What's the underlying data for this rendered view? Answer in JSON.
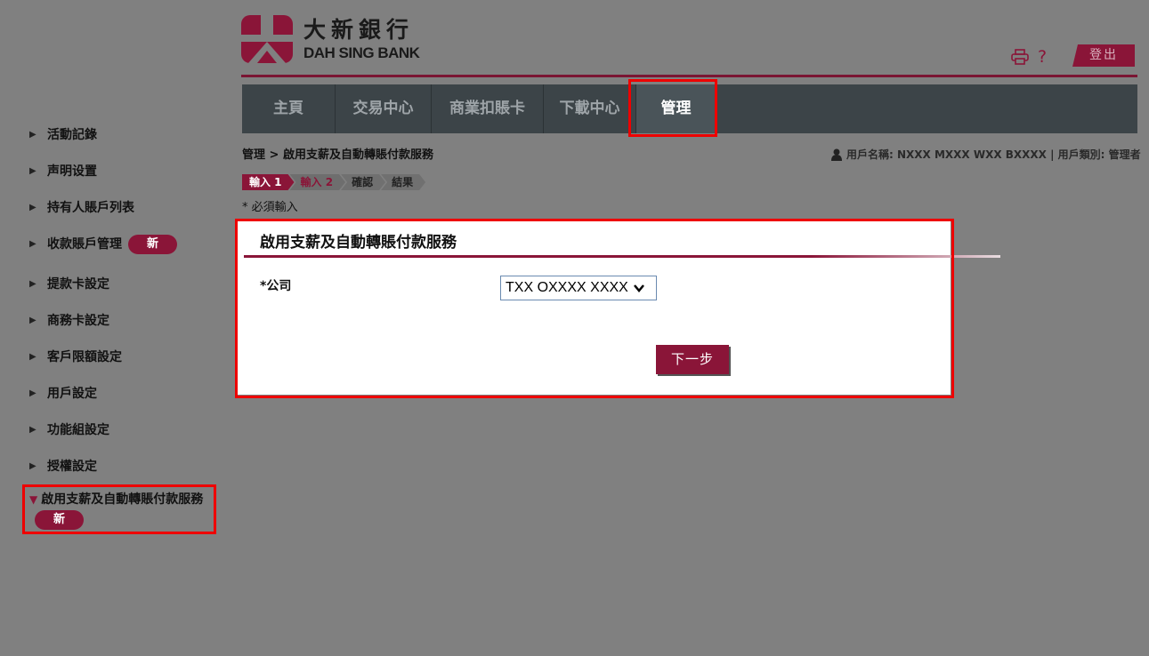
{
  "header": {
    "logo_cn": "大新銀行",
    "logo_en": "DAH SING BANK",
    "help": "?",
    "logout": "登出"
  },
  "nav": {
    "items": [
      {
        "label": "主頁"
      },
      {
        "label": "交易中心"
      },
      {
        "label": "商業扣賬卡"
      },
      {
        "label": "下載中心"
      },
      {
        "label": "管理"
      }
    ],
    "active": "管理"
  },
  "breadcrumb": "管理 > 啟用支薪及自動轉賬付款服務",
  "user_info": "用戶名稱: NXXX MXXX WXX BXXXX | 用戶類別: 管理者",
  "steps": [
    "輸入 1",
    "輸入 2",
    "確認",
    "結果"
  ],
  "required_note": "* 必須輸入",
  "form": {
    "title": "啟用支薪及自動轉賬付款服務",
    "company_label": "*公司",
    "company_value": "TXX OXXXX XXXX",
    "next_label": "下一步"
  },
  "sidebar": {
    "items": [
      {
        "label": "活動記錄"
      },
      {
        "label": "声明设置"
      },
      {
        "label": "持有人賬戶列表"
      },
      {
        "label": "收款賬戶管理",
        "badge": "新"
      },
      {
        "label": "提款卡設定"
      },
      {
        "label": "商務卡設定"
      },
      {
        "label": "客戶限額設定"
      },
      {
        "label": "用戶設定"
      },
      {
        "label": "功能組設定"
      },
      {
        "label": "授權設定"
      }
    ],
    "active_item": {
      "label": "啟用支薪及自動轉賬付款服務",
      "badge": "新"
    }
  },
  "colors": {
    "brand": "#8a1538",
    "nav_bg": "#3c4448",
    "highlight": "#ee0000"
  }
}
